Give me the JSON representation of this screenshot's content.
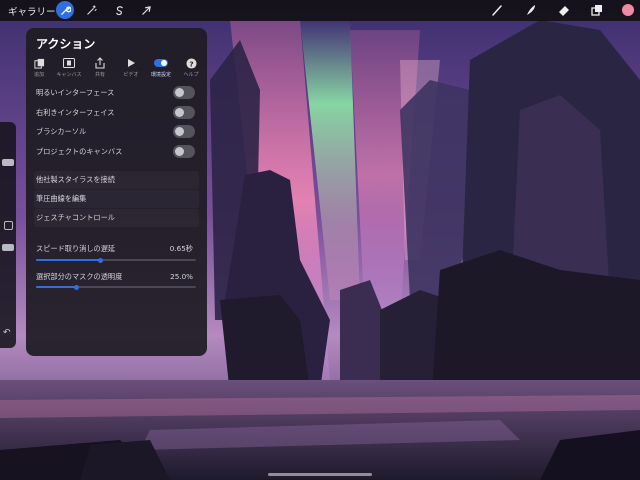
{
  "topbar": {
    "gallery_label": "ギャラリー",
    "tools": [
      "brush-icon",
      "smudge-icon",
      "eraser-icon",
      "layers-icon"
    ],
    "color_swatch": "#f08aa4",
    "accent": "#2f6fe0"
  },
  "panel": {
    "title": "アクション",
    "categories": [
      {
        "label": "追加",
        "icon": "add-icon"
      },
      {
        "label": "キャンバス",
        "icon": "canvas-icon"
      },
      {
        "label": "共有",
        "icon": "share-icon"
      },
      {
        "label": "ビデオ",
        "icon": "video-icon"
      },
      {
        "label": "環境設定",
        "icon": "prefs-toggle-icon",
        "selected": true
      },
      {
        "label": "ヘルプ",
        "icon": "help-icon"
      }
    ],
    "toggles": [
      {
        "label": "明るいインターフェース",
        "on": false
      },
      {
        "label": "右利きインターフェイス",
        "on": false
      },
      {
        "label": "ブラシカーソル",
        "on": false
      },
      {
        "label": "プロジェクトのキャンバス",
        "on": false
      }
    ],
    "links": [
      {
        "label": "他社製スタイラスを接続"
      },
      {
        "label": "筆圧曲線を編集"
      },
      {
        "label": "ジェスチャコントロール"
      }
    ],
    "sliders": [
      {
        "label": "スピード取り消しの遅延",
        "value": "0.65秒",
        "fraction": 0.4
      },
      {
        "label": "選択部分のマスクの透明度",
        "value": "25.0%",
        "fraction": 0.25
      }
    ]
  }
}
